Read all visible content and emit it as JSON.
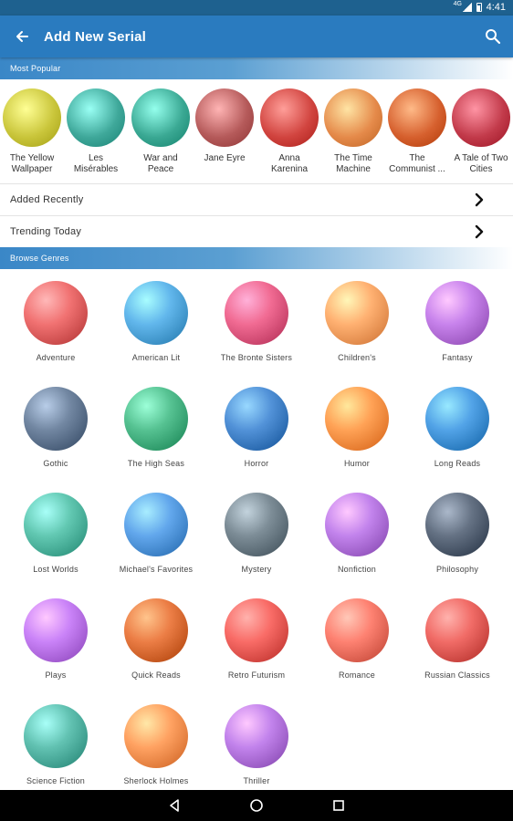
{
  "status": {
    "time": "4:41",
    "network": "4G"
  },
  "appbar": {
    "title": "Add New Serial",
    "back_icon": "arrow-back-icon",
    "search_icon": "search-icon"
  },
  "popular": {
    "header": "Most Popular",
    "items": [
      {
        "line1": "The Yellow",
        "line2": "Wallpaper",
        "color": "#c9c53a"
      },
      {
        "line1": "Les",
        "line2": "Misérables",
        "color": "#3fa89a"
      },
      {
        "line1": "War and",
        "line2": "Peace",
        "color": "#3aa893"
      },
      {
        "line1": "Jane Eyre",
        "line2": "",
        "color": "#b55a5a"
      },
      {
        "line1": "Anna",
        "line2": "Karenina",
        "color": "#d1443f"
      },
      {
        "line1": "The Time",
        "line2": "Machine",
        "color": "#e58a4a"
      },
      {
        "line1": "The",
        "line2": "Communist ...",
        "color": "#d6602e"
      },
      {
        "line1": "A Tale of Two",
        "line2": "Cities",
        "color": "#c23a4a"
      }
    ]
  },
  "links": {
    "added_recently": "Added Recently",
    "trending_today": "Trending Today"
  },
  "genres": {
    "header": "Browse Genres",
    "items": [
      {
        "label": "Adventure",
        "color": "#c94a4a"
      },
      {
        "label": "American Lit",
        "color": "#3a8fc4"
      },
      {
        "label": "The Bronte Sisters",
        "color": "#c9436b"
      },
      {
        "label": "Children's",
        "color": "#e0894a"
      },
      {
        "label": "Fantasy",
        "color": "#a05bc4"
      },
      {
        "label": "Gothic",
        "color": "#4a5f7a"
      },
      {
        "label": "The High Seas",
        "color": "#2e9a6a"
      },
      {
        "label": "Horror",
        "color": "#2a6ab0"
      },
      {
        "label": "Humor",
        "color": "#e57a2e"
      },
      {
        "label": "Long Reads",
        "color": "#2a7bbf"
      },
      {
        "label": "Lost Worlds",
        "color": "#3aa08a"
      },
      {
        "label": "Michael's Favorites",
        "color": "#3a7fc4"
      },
      {
        "label": "Mystery",
        "color": "#55656f"
      },
      {
        "label": "Nonfiction",
        "color": "#9a5bc4"
      },
      {
        "label": "Philosophy",
        "color": "#3d4a5c"
      },
      {
        "label": "Plays",
        "color": "#a25bd0"
      },
      {
        "label": "Quick Reads",
        "color": "#c4561e"
      },
      {
        "label": "Retro Futurism",
        "color": "#d1443f"
      },
      {
        "label": "Romance",
        "color": "#d65a4a"
      },
      {
        "label": "Russian Classics",
        "color": "#c9443f"
      },
      {
        "label": "Science Fiction",
        "color": "#3a9a8a"
      },
      {
        "label": "Sherlock Holmes",
        "color": "#e07a3a"
      },
      {
        "label": "Thriller",
        "color": "#9a5bc4"
      }
    ]
  },
  "nav": {
    "back_icon": "nav-back-icon",
    "home_icon": "nav-home-icon",
    "recents_icon": "nav-recents-icon"
  }
}
